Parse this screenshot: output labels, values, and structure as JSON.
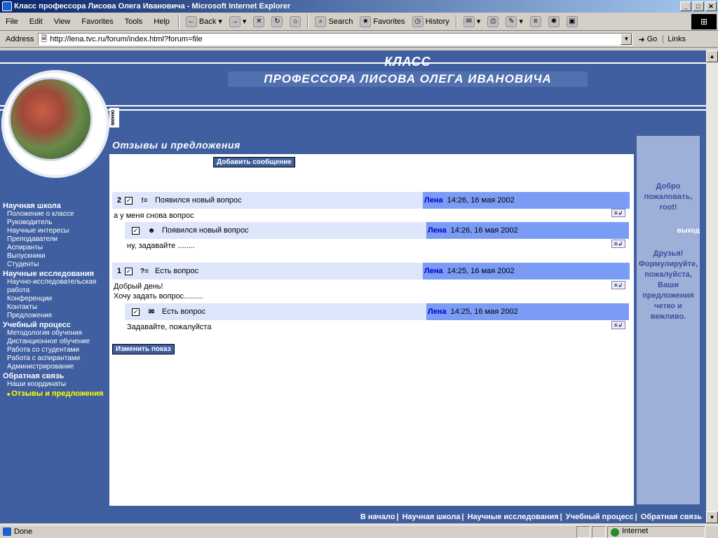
{
  "window": {
    "title": "Класс профессора Лисова Олега Ивановича - Microsoft Internet Explorer"
  },
  "menu": [
    "File",
    "Edit",
    "View",
    "Favorites",
    "Tools",
    "Help"
  ],
  "toolbar": {
    "back": "Back",
    "search": "Search",
    "favorites": "Favorites",
    "history": "History"
  },
  "address": {
    "label": "Address",
    "url": "http://lena.tvc.ru/forum/index.html?forum=file",
    "go": "Go",
    "links": "Links"
  },
  "header": {
    "line1": "КЛАСС",
    "line2": "ПРОФЕССОРА ЛИСОВА ОЛЕГА ИВАНОВИЧА",
    "menu_tab": "меню"
  },
  "sidebar": [
    {
      "section": "Научная школа",
      "items": [
        "Положение о классе",
        "Руководитель",
        "Научные интересы",
        "Преподаватели",
        "Аспиранты",
        "Выпускники",
        "Студенты"
      ]
    },
    {
      "section": "Научные исследования",
      "items": [
        "Научно-исследовательская работа",
        "Конференции",
        "Контакты",
        "Предложения"
      ]
    },
    {
      "section": "Учебный процесс",
      "items": [
        "Методология обучения",
        "Дистанционное обучение",
        "Работа со студентами",
        "Работа с аспирантами",
        "Администрирование"
      ]
    },
    {
      "section": "Обратная связь",
      "items": [
        "Наши координаты",
        "Отзывы и предложения"
      ]
    }
  ],
  "forum": {
    "title": "Отзывы и предложения",
    "add_button": "Добавить сообщение",
    "change_button": "Изменить показ",
    "threads": [
      {
        "num": "2",
        "icon": "!≡",
        "subject": "Появился новый вопрос",
        "author": "Лена",
        "date": "14:26, 16 мая 2002",
        "body": "а у меня снова вопрос",
        "reply": {
          "icon": "☻",
          "subject": "Появился новый вопрос",
          "author": "Лена",
          "date": "14:26, 16 мая 2002",
          "body": "ну, задавайте ........"
        }
      },
      {
        "num": "1",
        "icon": "?≡",
        "subject": "Есть вопрос",
        "author": "Лена",
        "date": "14:25, 16 мая 2002",
        "body_line1": "Добрый день!",
        "body_line2": "Хочу задать вопрос.........",
        "reply": {
          "icon": "✉",
          "subject": "Есть вопрос",
          "author": "Лена",
          "date": "14:25, 16 мая 2002",
          "body": "Задавайте, пожалуйста"
        }
      }
    ]
  },
  "right": {
    "welcome": "Добро пожаловать, root!",
    "exit": "выход",
    "friends": "Друзья! Формулируйте, пожалуйста, Ваши предложения четко и вежливо."
  },
  "footer": [
    "В начало",
    "Научная школа",
    "Научные исследования",
    "Учебный процесс",
    "Обратная связь"
  ],
  "status": {
    "left": "Done",
    "zone": "Internet"
  }
}
